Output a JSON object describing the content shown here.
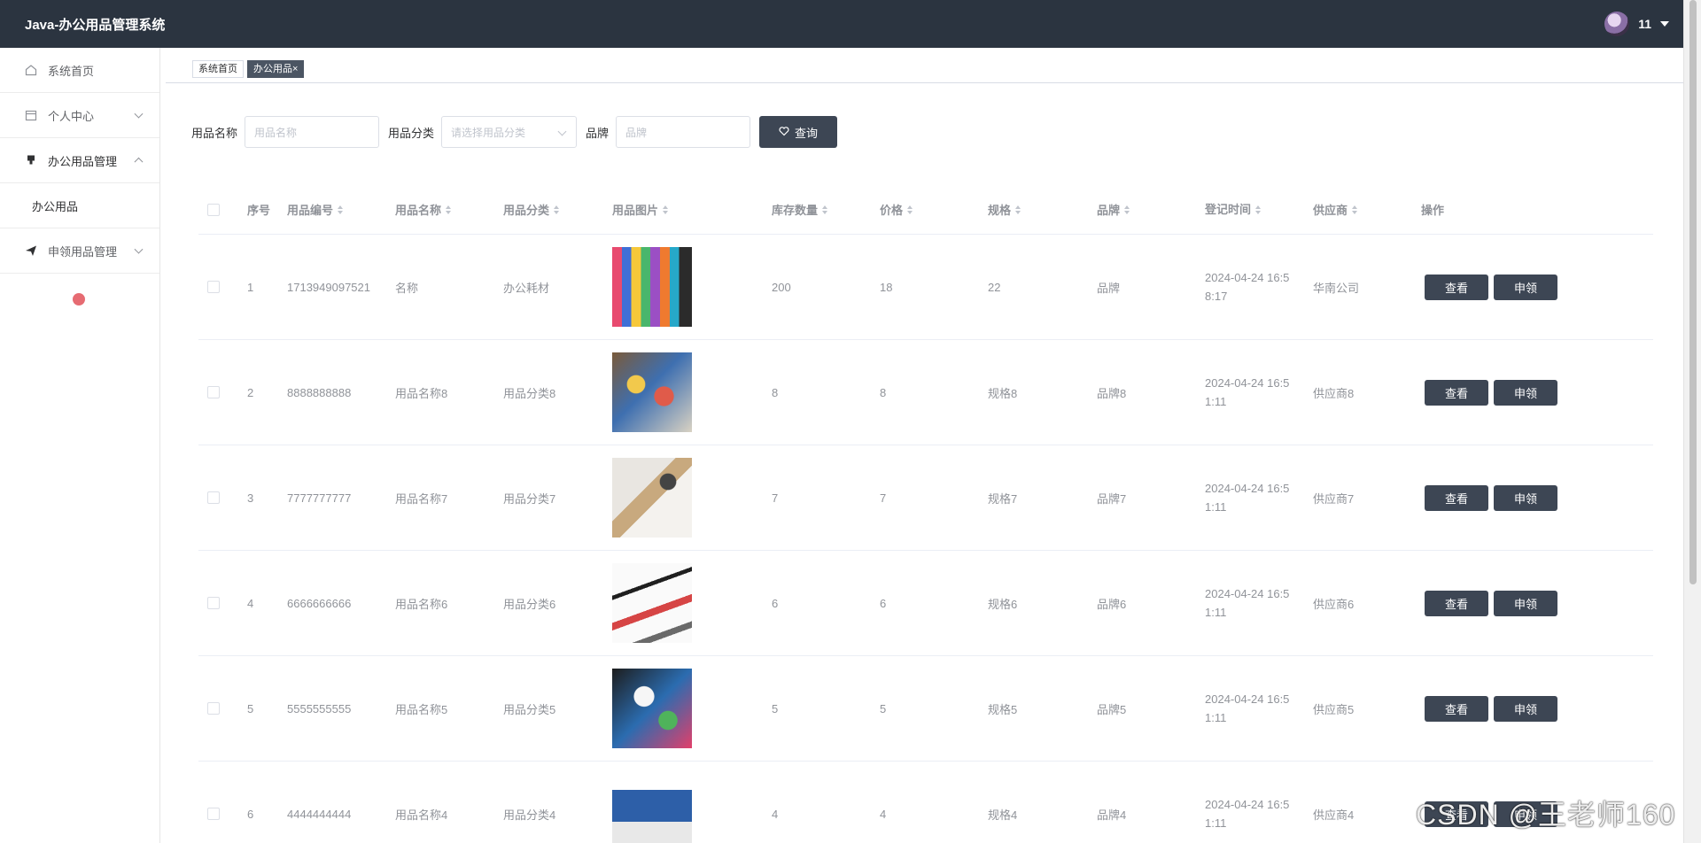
{
  "header": {
    "app_title": "Java-办公用品管理系统",
    "username": "11"
  },
  "sidebar": {
    "items": [
      {
        "label": "系统首页",
        "icon": "home-icon"
      },
      {
        "label": "个人中心",
        "icon": "calendar-icon",
        "arrow": "down"
      },
      {
        "label": "办公用品管理",
        "icon": "stamp-icon",
        "arrow": "up"
      },
      {
        "label": "办公用品"
      },
      {
        "label": "申领用品管理",
        "icon": "send-icon",
        "arrow": "down"
      }
    ]
  },
  "tags": {
    "home": "系统首页",
    "active": "办公用品×"
  },
  "search": {
    "name_label": "用品名称",
    "name_placeholder": "用品名称",
    "category_label": "用品分类",
    "category_placeholder": "请选择用品分类",
    "brand_label": "品牌",
    "brand_placeholder": "品牌",
    "button_label": "查询"
  },
  "table": {
    "headers": [
      "序号",
      "用品编号",
      "用品名称",
      "用品分类",
      "用品图片",
      "库存数量",
      "价格",
      "规格",
      "品牌",
      "登记时间",
      "供应商",
      "操作"
    ],
    "view_label": "查看",
    "apply_label": "申领",
    "rows": [
      {
        "index": "1",
        "code": "1713949097521",
        "name": "名称",
        "category": "办公耗材",
        "stock": "200",
        "price": "18",
        "spec": "22",
        "brand": "品牌",
        "time_a": "2024-04-24 16:5",
        "time_b": "8:17",
        "supplier": "华南公司"
      },
      {
        "index": "2",
        "code": "8888888888",
        "name": "用品名称8",
        "category": "用品分类8",
        "stock": "8",
        "price": "8",
        "spec": "规格8",
        "brand": "品牌8",
        "time_a": "2024-04-24 16:5",
        "time_b": "1:11",
        "supplier": "供应商8"
      },
      {
        "index": "3",
        "code": "7777777777",
        "name": "用品名称7",
        "category": "用品分类7",
        "stock": "7",
        "price": "7",
        "spec": "规格7",
        "brand": "品牌7",
        "time_a": "2024-04-24 16:5",
        "time_b": "1:11",
        "supplier": "供应商7"
      },
      {
        "index": "4",
        "code": "6666666666",
        "name": "用品名称6",
        "category": "用品分类6",
        "stock": "6",
        "price": "6",
        "spec": "规格6",
        "brand": "品牌6",
        "time_a": "2024-04-24 16:5",
        "time_b": "1:11",
        "supplier": "供应商6"
      },
      {
        "index": "5",
        "code": "5555555555",
        "name": "用品名称5",
        "category": "用品分类5",
        "stock": "5",
        "price": "5",
        "spec": "规格5",
        "brand": "品牌5",
        "time_a": "2024-04-24 16:5",
        "time_b": "1:11",
        "supplier": "供应商5"
      },
      {
        "index": "6",
        "code": "4444444444",
        "name": "用品名称4",
        "category": "用品分类4",
        "stock": "4",
        "price": "4",
        "spec": "规格4",
        "brand": "品牌4",
        "time_a": "2024-04-24 16:5",
        "time_b": "1:11",
        "supplier": "供应商4"
      }
    ]
  },
  "watermark": "CSDN @王老师160",
  "colors": {
    "header_bg": "#2b3440",
    "button_bg": "#3d4654",
    "active_tag": "#4b5563"
  }
}
